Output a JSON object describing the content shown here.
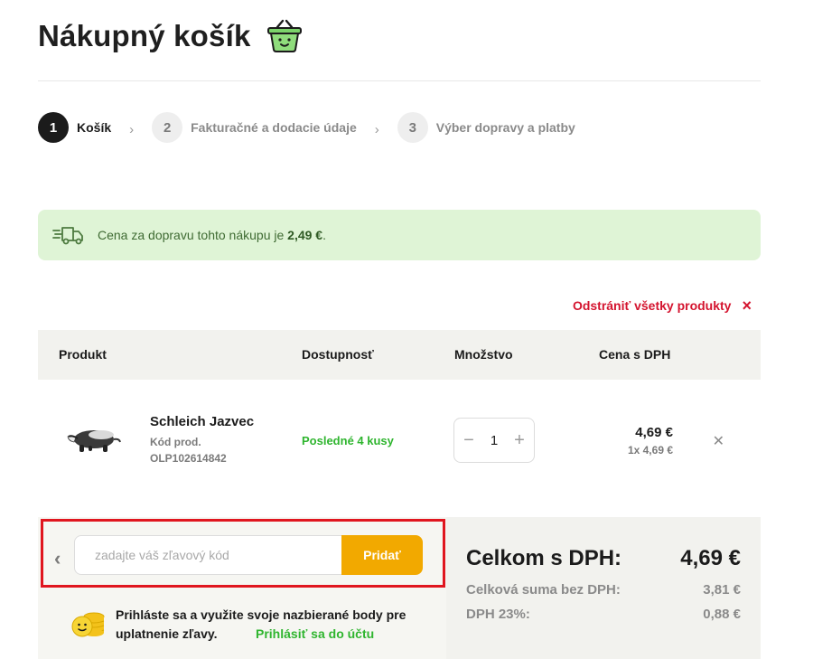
{
  "page": {
    "title": "Nákupný košík",
    "steps": [
      {
        "num": "1",
        "label": "Košík"
      },
      {
        "num": "2",
        "label": "Fakturačné a dodacie údaje"
      },
      {
        "num": "3",
        "label": "Výber dopravy a platby"
      }
    ]
  },
  "shipping": {
    "text": "Cena za dopravu tohto nákupu je ",
    "price": "2,49 €",
    "suffix": "."
  },
  "remove_all": {
    "label": "Odstrániť všetky produkty",
    "icon": "×"
  },
  "table": {
    "headers": {
      "product": "Produkt",
      "availability": "Dostupnosť",
      "quantity": "Množstvo",
      "price": "Cena s DPH"
    }
  },
  "item": {
    "name": "Schleich Jazvec",
    "code_label": "Kód prod.",
    "code": "OLP102614842",
    "availability": "Posledné 4 kusy",
    "quantity": "1",
    "price": "4,69 €",
    "unit_price": "1x 4,69 €"
  },
  "coupon": {
    "placeholder": "zadajte váš zľavový kód",
    "button": "Pridať"
  },
  "loyalty": {
    "text": "Prihláste sa a využite svoje nazbierané body pre uplatnenie zľavy.",
    "link": "Prihlásiť sa do účtu"
  },
  "summary": {
    "total_label": "Celkom s DPH:",
    "total_value": "4,69 €",
    "net_label": "Celková suma bez DPH:",
    "net_value": "3,81 €",
    "vat_label": "DPH 23%:",
    "vat_value": "0,88 €"
  },
  "colors": {
    "accent_yellow": "#f2a900",
    "green": "#2fb52f",
    "red": "#d4142f",
    "highlight_box": "#e0161f"
  }
}
